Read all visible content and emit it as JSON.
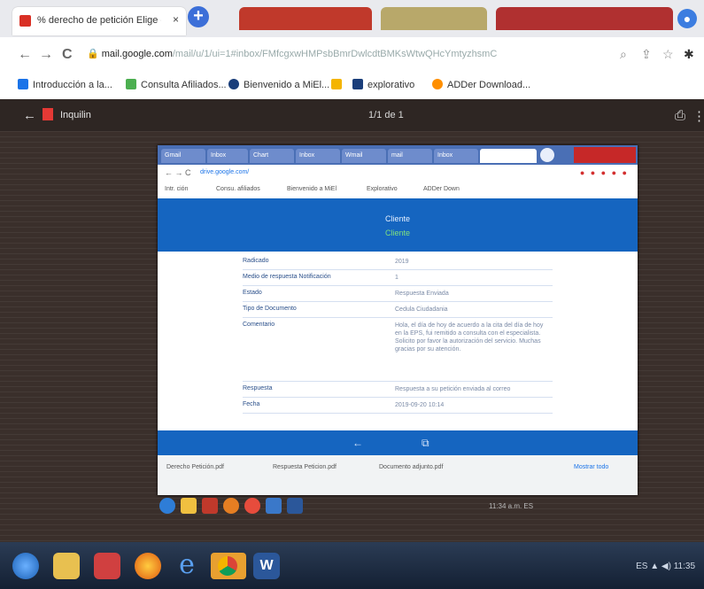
{
  "browser": {
    "tab_title": "% derecho de petición Elige - de",
    "tab_close": "×",
    "new_tab": "+",
    "profile_icon": "person-icon",
    "url_host": "mail.google.com",
    "url_rest": "/mail/u/1/ui=1#inbox/FMfcgxwHMPsbBmrDwlcdtBMKsWtwQHcYmtyzhsmC",
    "nav_back": "←",
    "nav_forward": "→",
    "nav_reload": "C",
    "bookmarks": [
      {
        "label": "Introducción a la...",
        "color": "#1a73e8"
      },
      {
        "label": "Consulta Afiliados...",
        "color": "#4caf50"
      },
      {
        "label": "Bienvenido a MiEl...",
        "color": "#1a3e7a"
      },
      {
        "label": "",
        "color": "#f4b400"
      },
      {
        "label": "explorativo",
        "color": "#1a3e7a"
      },
      {
        "label": "ADDer Download...",
        "color": "#ff8f00"
      }
    ]
  },
  "viewer": {
    "file_name": "Inquilin",
    "page_indicator": "1/1 de 1",
    "back": "←"
  },
  "inner": {
    "tabs": [
      "Gmail",
      "Inbox",
      "Chart",
      "Inbox",
      "Wmail",
      "mail",
      "Inbox",
      ""
    ],
    "address": "drive.google.com/",
    "bookmarks": [
      "Intr. ción",
      "Consu. afiliados",
      "Bienvenido a MiEl",
      "Explorativo",
      "ADDer Down"
    ],
    "header_line1": "Cliente",
    "header_line2": "Cliente",
    "rows": [
      {
        "key": "Radicado",
        "value": "2019"
      },
      {
        "key": "Medio de respuesta Notificación",
        "value": "1"
      },
      {
        "key": "Estado",
        "value": "Respuesta Enviada"
      },
      {
        "key": "Tipo de Documento",
        "value": "Cedula Ciudadania"
      },
      {
        "key": "Comentario",
        "value": "Hola, el día de hoy de acuerdo a la cita del día de hoy en la EPS, fui remitido a consulta con el especialista. Solicito por favor la autorización del servicio. Muchas gracias por su atención."
      },
      {
        "key": "Respuesta",
        "value": "Respuesta a su petición enviada al correo"
      },
      {
        "key": "Fecha",
        "value": "2019-09-20 10:14"
      }
    ],
    "footer_prev": "←",
    "footer_next": "⧉",
    "downloads": [
      "Derecho Petición.pdf",
      "Respuesta Peticion.pdf",
      "Documento adjunto.pdf",
      "Mostrar todo"
    ]
  },
  "inner_tray": "11:34 a.m. ES",
  "taskbar": {
    "apps": [
      "windows-start-icon",
      "file-explorer-icon",
      "media-player-icon",
      "firefox-icon",
      "internet-explorer-icon",
      "chrome-icon",
      "word-icon"
    ],
    "tray": "ES  ▲  ◀)  11:35"
  }
}
